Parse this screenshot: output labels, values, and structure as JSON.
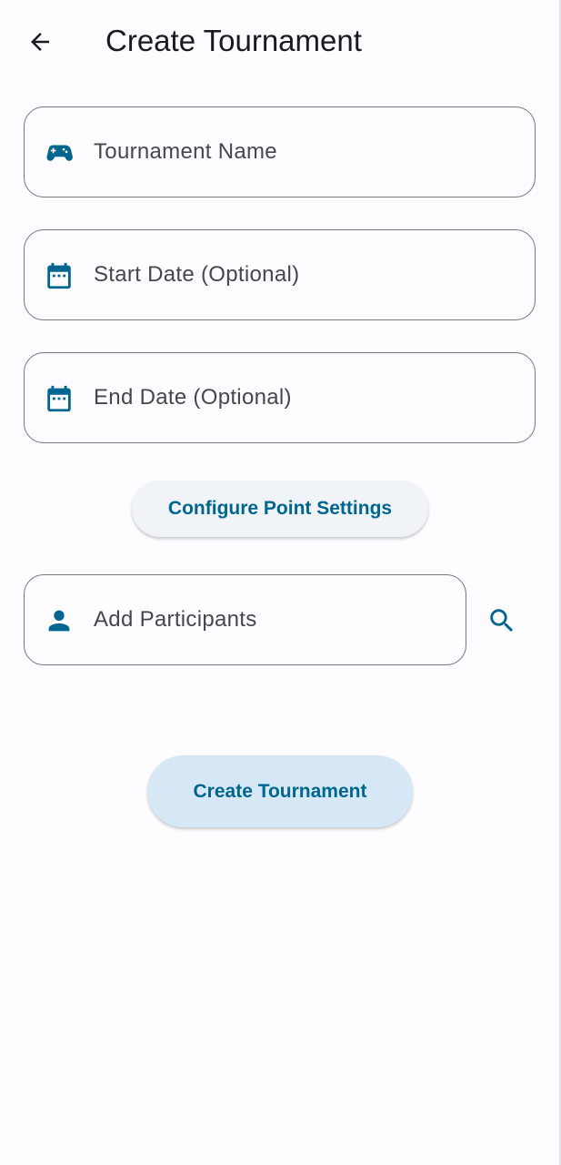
{
  "app_bar": {
    "title": "Create Tournament",
    "back_icon": "arrow-back-icon"
  },
  "form": {
    "tournament_name": {
      "placeholder": "Tournament Name",
      "icon": "gamepad-icon",
      "value": ""
    },
    "start_date": {
      "placeholder": "Start Date (Optional)",
      "icon": "calendar-icon",
      "value": ""
    },
    "end_date": {
      "placeholder": "End Date (Optional)",
      "icon": "calendar-icon",
      "value": ""
    },
    "configure_button_label": "Configure Point Settings",
    "participants": {
      "placeholder": "Add Participants",
      "icon": "person-icon",
      "search_icon": "search-icon",
      "value": ""
    },
    "create_button_label": "Create Tournament"
  },
  "colors": {
    "accent": "#00658f",
    "background": "#fdfcff",
    "outline": "#75777f",
    "create_button_bg": "#d6e8f6",
    "config_button_bg": "#f0f3f8"
  }
}
